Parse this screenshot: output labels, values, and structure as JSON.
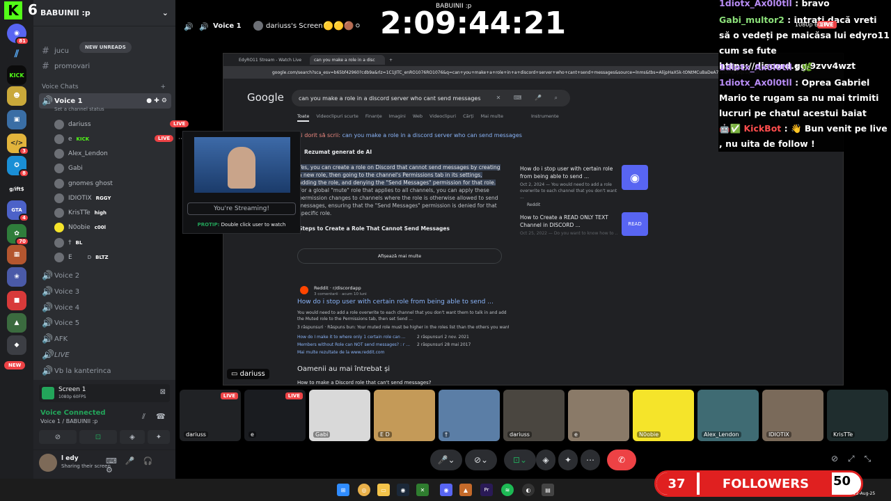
{
  "kick_badge": {
    "logo": "K",
    "count": "6"
  },
  "rail": {
    "badges": [
      "81",
      "3",
      "8",
      "4",
      "70"
    ],
    "new_label": "NEW",
    "servers": [
      "discord-home-icon",
      "blue-wing-server",
      "kick-server",
      "minion-server",
      "game-server",
      "code-server",
      "blue-server",
      "gifting-server",
      "gta-server",
      "spirit-server",
      "pixel-server",
      "waifu-server",
      "red-server",
      "green-server",
      "dark-server",
      "cat-server"
    ],
    "glifts_text": "g/ift$"
  },
  "sidebar": {
    "server_name": "BABUINII :p",
    "new_unreads": "NEW UNREADS",
    "channels_top": [
      {
        "icon": "#",
        "label": "jucu"
      },
      {
        "icon": "#",
        "label": "promovari"
      }
    ],
    "category": "Voice Chats",
    "active_channel": "Voice 1",
    "channel_status": "Set a channel status",
    "users": [
      {
        "name": "dariuss",
        "live": "LIVE"
      },
      {
        "name": "e",
        "tag": "KICK",
        "live": "LIVE"
      },
      {
        "name": "Alex_Lendon"
      },
      {
        "name": "Gabi"
      },
      {
        "name": "gnomes ghost"
      },
      {
        "name": "IDIOTIX",
        "tag": "RGGY"
      },
      {
        "name": "KrisTTe",
        "tag": "high"
      },
      {
        "name": "N0obie",
        "tag": "c00l"
      },
      {
        "name": "†",
        "tag": "BL"
      },
      {
        "name": "E",
        "tag": "D",
        "extra": "BLTZ"
      }
    ],
    "voice_channels": [
      "Voice 2",
      "Voice 3",
      "Voice 4",
      "Voice 5",
      "AFK",
      "LIVE",
      "Vb la kanterinca"
    ]
  },
  "panel": {
    "screen_title": "Screen 1",
    "screen_sub": "1080p 60FPS",
    "voice_connected": "Voice Connected",
    "voice_location": "Voice 1 / BABUINII :p",
    "user_name": "l edy",
    "user_status": "Sharing their screen"
  },
  "stage": {
    "channel": "Voice 1",
    "screen_title": "dariuss's Screen",
    "clock": "2:09:44:21",
    "window_title": "BABUINII :p",
    "quality": "1080p 60FPS",
    "live": "LIVE"
  },
  "browser": {
    "tabs": [
      "EdyRO11 Stream - Watch Live",
      "can you make a role in a disc"
    ],
    "url": "google.com/search?sca_esv=b65bf42960?cdb9a&rlz=1C1JITC_enRO1076RO1076&q=can+you+make+a+role+in+a+discord+server+who+cant+send+messages&source=lnms&tbs=AlijpHaX5k-tONtMCuBaDeA7E5WMgPpqESqQ8D8h14C0q8gYK...",
    "logo": "Google",
    "query": "can you make a role in a discord server who cant send messages",
    "tabs_search": [
      "Toate",
      "Videoclipuri scurte",
      "Finanțe",
      "Imagini",
      "Web",
      "Videoclipuri",
      "Cărți",
      "Mai multe"
    ],
    "tools": "Instrumente",
    "did_you_mean_prefix": "Ai dorit să scrii:",
    "did_you_mean": "can you make a role in a discord server who can send messages",
    "ai_label": "Rezumat generat de AI",
    "ai_text_hl": "Yes, you can create a role on Discord that cannot send messages by creating a new role, then going to the channel's Permissions tab in its settings, adding the role, and denying the \"Send Messages\" permission for that role.",
    "ai_text": " For a global \"mute\" role that applies to all channels, you can apply these permission changes to channels where the role is otherwise allowed to send messages, ensuring that the \"Send Messages\" permission is denied for that specific role.",
    "steps_heading": "Steps to Create a Role That Cannot Send Messages",
    "show_more": "Afișează mai multe",
    "side_cards": [
      {
        "title": "How do i stop user with certain role from being able to send ...",
        "date": "Oct 2, 2024 — You would need to add a role overwrite to each channel that you don't want ...",
        "src": "Reddit"
      },
      {
        "title": "How to Create a READ ONLY TEXT Channel in DISCORD ...",
        "date": "Oct 25, 2022 — Do you want to know how to ..."
      }
    ],
    "result": {
      "src": "Reddit",
      "sub": "r/discordapp",
      "meta": "3 comentarii · acum 10 luni",
      "title": "How do i stop user with certain role from being able to send ...",
      "snippet": "You would need to add a role overwrite to each channel that you don't want them to talk in and add the Muted role to the Permissions tab, then set Send ...",
      "answers": "3 răspunsuri · Răspuns bun: Your muted role must be higher in the roles list than the others you want t...",
      "links": [
        {
          "t": "How do I make it to where only 1 certain role can ...",
          "c": "2 răspunsuri",
          "d": "2 nov. 2021"
        },
        {
          "t": "Members without Role can NOT send messages? : r ...",
          "c": "2 răspunsuri",
          "d": "28 mai 2017"
        }
      ],
      "more": "Mai multe rezultate de la www.reddit.com"
    },
    "paa": "Oamenii au mai întrebat și",
    "paa_q": "How to make a Discord role that can't send messages?"
  },
  "pip": {
    "button": "You're Streaming!",
    "protip_label": "PROTIP:",
    "protip": "Double click user to watch"
  },
  "stage_user_label": "dariuss",
  "chat": [
    {
      "user": "1diotx_Ax0l0tll",
      "text": "bravo",
      "color": "#b88cf5"
    },
    {
      "user": "Gabi_multor2",
      "text": "intrati dacă vreti să o vedeți pe maicăsa lui edyro11 cum se fute https://discord.gg/9zvv4wzt",
      "color": "#8ce07a"
    },
    {
      "user": "1diotx_Ax0l0tll",
      "text": "",
      "color": "#b88cf5"
    },
    {
      "user": "1diotx_Ax0l0tll",
      "text": "Oprea Gabriel Mario te rugam sa nu mai trimiti lucruri pe chatul acestui baiat",
      "color": "#b88cf5"
    },
    {
      "user": "KickBot",
      "text": "Bun venit pe live , nu uita de follow !",
      "color": "#ff4d4d"
    }
  ],
  "tiles": [
    {
      "name": "dariuss",
      "live": "LIVE",
      "color": "#202225"
    },
    {
      "name": "e",
      "live": "LIVE",
      "color": "#1a1c20"
    },
    {
      "name": "Gabi",
      "color": "#d9d9d9"
    },
    {
      "name": "E  D",
      "color": "#c49a58"
    },
    {
      "name": "†",
      "color": "#5b7ea6"
    },
    {
      "name": "dariuss",
      "color": "#4a4640"
    },
    {
      "name": "e",
      "color": "#8a7a68"
    },
    {
      "name": "N0obie",
      "color": "#f5e42a"
    },
    {
      "name": "Alex_Lendon",
      "color": "#3f6b73"
    },
    {
      "name": "IDIOTIX",
      "color": "#7a6a5a"
    },
    {
      "name": "KrisTTe",
      "color": "#1f2d2e"
    }
  ],
  "followers": {
    "count": "37",
    "label": "FOLLOWERS",
    "time": "50",
    "date": "22-Aug-25"
  },
  "colors": {
    "accent": "#5865f2",
    "green": "#23a55a",
    "red": "#ed4245",
    "kick": "#53fc18"
  }
}
